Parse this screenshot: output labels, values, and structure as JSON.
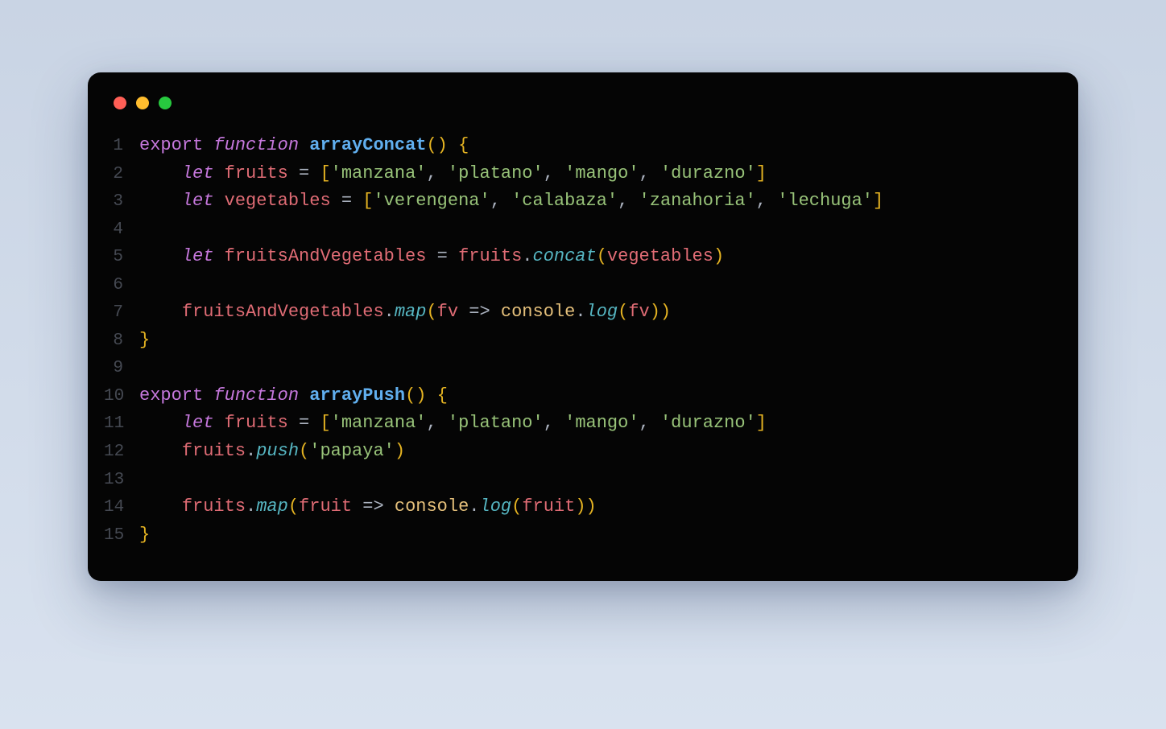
{
  "colors": {
    "bg_top": "#c9d4e4",
    "bg_bottom": "#d9e2ef",
    "window": "#050505",
    "gutter": "#454952",
    "export": "#c678dd",
    "keyword": "#c678dd",
    "function_name": "#61afef",
    "identifier": "#e06c75",
    "default_text": "#abb2bf",
    "brace": "#e6b422",
    "string": "#98c379",
    "method": "#56b6c2",
    "const": "#e5c07b",
    "dot_red": "#ff5f56",
    "dot_yellow": "#ffbd2e",
    "dot_green": "#27c93f"
  },
  "line_numbers": [
    "1",
    "2",
    "3",
    "4",
    "5",
    "6",
    "7",
    "8",
    "9",
    "10",
    "11",
    "12",
    "13",
    "14",
    "15"
  ],
  "code": [
    [
      {
        "cls": "tok-export",
        "t": "export"
      },
      {
        "cls": "tok-pun",
        "t": " "
      },
      {
        "cls": "tok-keyword",
        "t": "function"
      },
      {
        "cls": "tok-pun",
        "t": " "
      },
      {
        "cls": "tok-fn",
        "t": "arrayConcat"
      },
      {
        "cls": "tok-brace",
        "t": "()"
      },
      {
        "cls": "tok-pun",
        "t": " "
      },
      {
        "cls": "tok-brace",
        "t": "{"
      }
    ],
    [
      {
        "cls": "tok-pun",
        "t": "    "
      },
      {
        "cls": "tok-let",
        "t": "let"
      },
      {
        "cls": "tok-pun",
        "t": " "
      },
      {
        "cls": "tok-ident",
        "t": "fruits"
      },
      {
        "cls": "tok-pun",
        "t": " "
      },
      {
        "cls": "tok-plain",
        "t": "="
      },
      {
        "cls": "tok-pun",
        "t": " "
      },
      {
        "cls": "tok-brace",
        "t": "["
      },
      {
        "cls": "tok-string",
        "t": "'manzana'"
      },
      {
        "cls": "tok-pun",
        "t": ", "
      },
      {
        "cls": "tok-string",
        "t": "'platano'"
      },
      {
        "cls": "tok-pun",
        "t": ", "
      },
      {
        "cls": "tok-string",
        "t": "'mango'"
      },
      {
        "cls": "tok-pun",
        "t": ", "
      },
      {
        "cls": "tok-string",
        "t": "'durazno'"
      },
      {
        "cls": "tok-brace",
        "t": "]"
      }
    ],
    [
      {
        "cls": "tok-pun",
        "t": "    "
      },
      {
        "cls": "tok-let",
        "t": "let"
      },
      {
        "cls": "tok-pun",
        "t": " "
      },
      {
        "cls": "tok-ident",
        "t": "vegetables"
      },
      {
        "cls": "tok-pun",
        "t": " "
      },
      {
        "cls": "tok-plain",
        "t": "="
      },
      {
        "cls": "tok-pun",
        "t": " "
      },
      {
        "cls": "tok-brace",
        "t": "["
      },
      {
        "cls": "tok-string",
        "t": "'verengena'"
      },
      {
        "cls": "tok-pun",
        "t": ", "
      },
      {
        "cls": "tok-string",
        "t": "'calabaza'"
      },
      {
        "cls": "tok-pun",
        "t": ", "
      },
      {
        "cls": "tok-string",
        "t": "'zanahoria'"
      },
      {
        "cls": "tok-pun",
        "t": ", "
      },
      {
        "cls": "tok-string",
        "t": "'lechuga'"
      },
      {
        "cls": "tok-brace",
        "t": "]"
      }
    ],
    [],
    [
      {
        "cls": "tok-pun",
        "t": "    "
      },
      {
        "cls": "tok-let",
        "t": "let"
      },
      {
        "cls": "tok-pun",
        "t": " "
      },
      {
        "cls": "tok-ident",
        "t": "fruitsAndVegetables"
      },
      {
        "cls": "tok-pun",
        "t": " "
      },
      {
        "cls": "tok-plain",
        "t": "="
      },
      {
        "cls": "tok-pun",
        "t": " "
      },
      {
        "cls": "tok-ident",
        "t": "fruits"
      },
      {
        "cls": "tok-pun",
        "t": "."
      },
      {
        "cls": "tok-method",
        "t": "concat"
      },
      {
        "cls": "tok-brace",
        "t": "("
      },
      {
        "cls": "tok-ident",
        "t": "vegetables"
      },
      {
        "cls": "tok-brace",
        "t": ")"
      }
    ],
    [],
    [
      {
        "cls": "tok-pun",
        "t": "    "
      },
      {
        "cls": "tok-ident",
        "t": "fruitsAndVegetables"
      },
      {
        "cls": "tok-pun",
        "t": "."
      },
      {
        "cls": "tok-method",
        "t": "map"
      },
      {
        "cls": "tok-brace",
        "t": "("
      },
      {
        "cls": "tok-ident",
        "t": "fv"
      },
      {
        "cls": "tok-pun",
        "t": " "
      },
      {
        "cls": "tok-plain",
        "t": "=>"
      },
      {
        "cls": "tok-pun",
        "t": " "
      },
      {
        "cls": "tok-const",
        "t": "console"
      },
      {
        "cls": "tok-pun",
        "t": "."
      },
      {
        "cls": "tok-method",
        "t": "log"
      },
      {
        "cls": "tok-brace",
        "t": "("
      },
      {
        "cls": "tok-ident",
        "t": "fv"
      },
      {
        "cls": "tok-brace",
        "t": "))"
      }
    ],
    [
      {
        "cls": "tok-brace",
        "t": "}"
      }
    ],
    [],
    [
      {
        "cls": "tok-export",
        "t": "export"
      },
      {
        "cls": "tok-pun",
        "t": " "
      },
      {
        "cls": "tok-keyword",
        "t": "function"
      },
      {
        "cls": "tok-pun",
        "t": " "
      },
      {
        "cls": "tok-fn",
        "t": "arrayPush"
      },
      {
        "cls": "tok-brace",
        "t": "()"
      },
      {
        "cls": "tok-pun",
        "t": " "
      },
      {
        "cls": "tok-brace",
        "t": "{"
      }
    ],
    [
      {
        "cls": "tok-pun",
        "t": "    "
      },
      {
        "cls": "tok-let",
        "t": "let"
      },
      {
        "cls": "tok-pun",
        "t": " "
      },
      {
        "cls": "tok-ident",
        "t": "fruits"
      },
      {
        "cls": "tok-pun",
        "t": " "
      },
      {
        "cls": "tok-plain",
        "t": "="
      },
      {
        "cls": "tok-pun",
        "t": " "
      },
      {
        "cls": "tok-brace",
        "t": "["
      },
      {
        "cls": "tok-string",
        "t": "'manzana'"
      },
      {
        "cls": "tok-pun",
        "t": ", "
      },
      {
        "cls": "tok-string",
        "t": "'platano'"
      },
      {
        "cls": "tok-pun",
        "t": ", "
      },
      {
        "cls": "tok-string",
        "t": "'mango'"
      },
      {
        "cls": "tok-pun",
        "t": ", "
      },
      {
        "cls": "tok-string",
        "t": "'durazno'"
      },
      {
        "cls": "tok-brace",
        "t": "]"
      }
    ],
    [
      {
        "cls": "tok-pun",
        "t": "    "
      },
      {
        "cls": "tok-ident",
        "t": "fruits"
      },
      {
        "cls": "tok-pun",
        "t": "."
      },
      {
        "cls": "tok-method",
        "t": "push"
      },
      {
        "cls": "tok-brace",
        "t": "("
      },
      {
        "cls": "tok-string",
        "t": "'papaya'"
      },
      {
        "cls": "tok-brace",
        "t": ")"
      }
    ],
    [],
    [
      {
        "cls": "tok-pun",
        "t": "    "
      },
      {
        "cls": "tok-ident",
        "t": "fruits"
      },
      {
        "cls": "tok-pun",
        "t": "."
      },
      {
        "cls": "tok-method",
        "t": "map"
      },
      {
        "cls": "tok-brace",
        "t": "("
      },
      {
        "cls": "tok-ident",
        "t": "fruit"
      },
      {
        "cls": "tok-pun",
        "t": " "
      },
      {
        "cls": "tok-plain",
        "t": "=>"
      },
      {
        "cls": "tok-pun",
        "t": " "
      },
      {
        "cls": "tok-const",
        "t": "console"
      },
      {
        "cls": "tok-pun",
        "t": "."
      },
      {
        "cls": "tok-method",
        "t": "log"
      },
      {
        "cls": "tok-brace",
        "t": "("
      },
      {
        "cls": "tok-ident",
        "t": "fruit"
      },
      {
        "cls": "tok-brace",
        "t": "))"
      }
    ],
    [
      {
        "cls": "tok-brace",
        "t": "}"
      }
    ]
  ]
}
